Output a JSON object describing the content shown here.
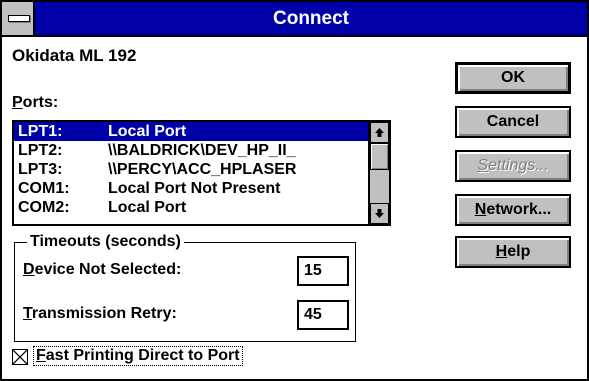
{
  "window": {
    "title": "Connect"
  },
  "device_name": "Okidata ML 192",
  "ports": {
    "label_mnemonic": "P",
    "label_rest": "orts:",
    "items": [
      {
        "name": "LPT1:",
        "desc": "Local Port",
        "selected": true
      },
      {
        "name": "LPT2:",
        "desc": "\\\\BALDRICK\\DEV_HP_II_",
        "selected": false
      },
      {
        "name": "LPT3:",
        "desc": "\\\\PERCY\\ACC_HPLASER",
        "selected": false
      },
      {
        "name": "COM1:",
        "desc": "Local Port Not Present",
        "selected": false
      },
      {
        "name": "COM2:",
        "desc": "Local Port",
        "selected": false
      }
    ]
  },
  "timeouts": {
    "title": "Timeouts (seconds)",
    "device_label_mnemonic": "D",
    "device_label_rest": "evice Not Selected:",
    "device_value": "15",
    "retry_label_mnemonic": "T",
    "retry_label_rest": "ransmission Retry:",
    "retry_value": "45"
  },
  "fast_printing": {
    "checked": true,
    "label_mnemonic": "F",
    "label_rest": "ast Printing Direct to Port"
  },
  "buttons": {
    "ok": "OK",
    "cancel": "Cancel",
    "settings_mnemonic": "S",
    "settings_rest": "ettings...",
    "network_mnemonic": "N",
    "network_rest": "etwork...",
    "help_mnemonic": "H",
    "help_rest": "elp"
  },
  "icons": {
    "system_menu": "system-menu-icon",
    "scroll_up": "scroll-up-arrow-icon",
    "scroll_down": "scroll-down-arrow-icon",
    "checkbox_mark": "checkbox-x-icon"
  },
  "colors": {
    "titlebar": "#0000a8",
    "selection": "#0000a8",
    "button_face": "#c0c0c0"
  }
}
